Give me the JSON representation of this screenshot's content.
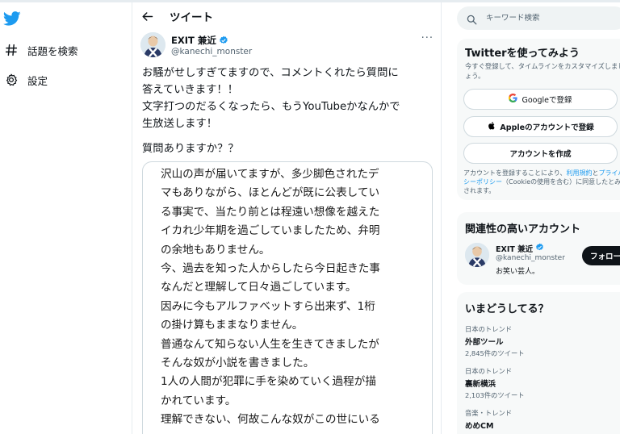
{
  "colors": {
    "accent": "#1d9bf0",
    "text": "#0f1419",
    "secondary": "#536471",
    "border": "#cfd9de",
    "panel": "#f7f9f9"
  },
  "nav": {
    "logo_icon": "twitter-bird-icon",
    "items": [
      {
        "icon": "hashtag-icon",
        "label": "話題を検索"
      },
      {
        "icon": "gear-icon",
        "label": "設定"
      }
    ]
  },
  "header": {
    "back_icon": "back-arrow-icon",
    "title": "ツイート"
  },
  "tweet": {
    "author": {
      "name": "EXIT 兼近",
      "handle": "@kanechi_monster",
      "verified": true
    },
    "more_icon": "ellipsis-icon",
    "text_lines": [
      "お騒がせしすぎてますので、コメントくれたら質問に",
      "答えていきます！！",
      "文字打つのだるくなったら、もうYouTubeかなんかで",
      "生放送します！"
    ],
    "question": "質問ありますか？？",
    "image_text_lines": [
      "沢山の声が届いてますが、多少脚色されたデ",
      "マもありながら、ほとんどが既に公表してい",
      "る事実で、当たり前とは程遠い想像を越えた",
      "イカれ少年期を過ごしていましたため、弁明",
      "の余地もありません。",
      "今、過去を知った人からしたら今日起きた事",
      "なんだと理解して日々過ごしています。",
      "因みに今もアルファベットすら出来ず、1桁",
      "の掛け算もままなりません。",
      "普通なんて知らない人生を生きてきましたが",
      "そんな奴が小説を書きました。",
      "1人の人間が犯罪に手を染めていく過程が描",
      "かれています。",
      "理解できない、何故こんな奴がこの世にいる"
    ]
  },
  "search": {
    "placeholder": "キーワード検索"
  },
  "signup": {
    "title": "Twitterを使ってみよう",
    "subtitle": "今すぐ登録して、タイムラインをカスタマイズしましょう。",
    "google_label": "Googleで登録",
    "apple_label": "Appleのアカウントで登録",
    "create_label": "アカウントを作成",
    "legal_prefix": "アカウントを登録することにより、",
    "legal_terms": "利用規約",
    "legal_and": "と",
    "legal_privacy": "プライバシーポリシー",
    "legal_cookie": "（Cookieの使用を含む）",
    "legal_suffix": "に同意したとみなされます。"
  },
  "related": {
    "title": "関連性の高いアカウント",
    "name": "EXIT 兼近",
    "handle": "@kanechi_monster",
    "bio": "お笑い芸人。",
    "follow_label": "フォロー"
  },
  "trends": {
    "title": "いまどうしてる？",
    "items": [
      {
        "category": "日本のトレンド",
        "name": "外部ツール",
        "count": "2,845件のツイート"
      },
      {
        "category": "日本のトレンド",
        "name": "裏新横浜",
        "count": "2,103件のツイート"
      },
      {
        "category": "音楽・トレンド",
        "name": "めめCM",
        "count": ""
      }
    ]
  }
}
